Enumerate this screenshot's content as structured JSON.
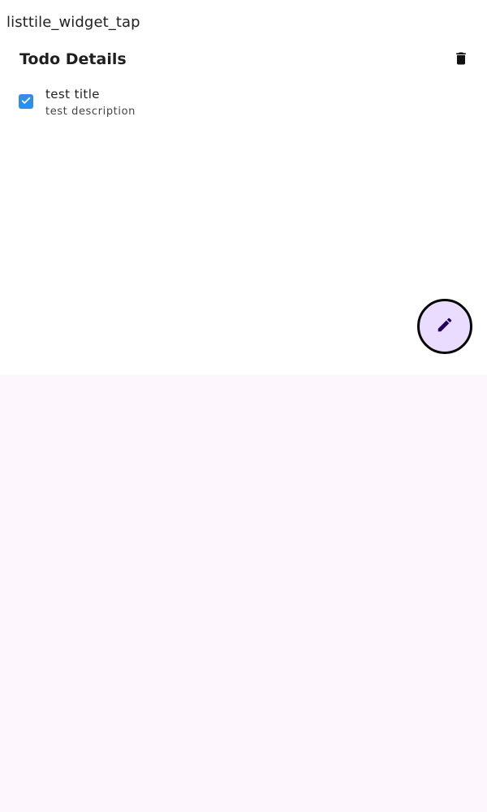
{
  "test_label": "listtile_widget_tap",
  "todo": {
    "header": "Todo Details",
    "title": "test title",
    "description": "test description",
    "checked": true
  },
  "icons": {
    "delete": "trash-icon",
    "checkbox": "check-icon",
    "edit": "pencil-icon"
  },
  "colors": {
    "checkbox": "#2f8fe8",
    "fab_background": "#eadcff",
    "fab_icon": "#21005d",
    "card_background": "#ffffff",
    "page_background": "#fdf7fd"
  }
}
